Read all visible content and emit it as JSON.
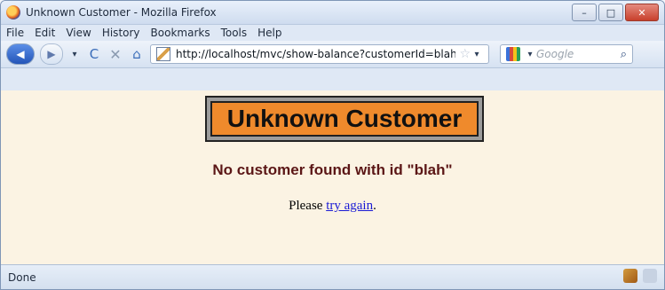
{
  "window": {
    "title": "Unknown Customer - Mozilla Firefox",
    "buttons": [
      "–",
      "□",
      "✕"
    ]
  },
  "menu": {
    "items": [
      {
        "label": "File"
      },
      {
        "label": "Edit"
      },
      {
        "label": "View"
      },
      {
        "label": "History"
      },
      {
        "label": "Bookmarks"
      },
      {
        "label": "Tools"
      },
      {
        "label": "Help"
      }
    ]
  },
  "navigation": {
    "url": "http://localhost/mvc/show-balance?customerId=blah",
    "search_placeholder": "Google",
    "back_glyph": "◀",
    "forward_glyph": "▶",
    "reload_glyph": "C",
    "stop_glyph": "✕",
    "home_glyph": "⌂",
    "star_glyph": "☆",
    "search_glyph": "⌕"
  },
  "page": {
    "heading": "Unknown Customer",
    "message": "No customer found with id \"blah\"",
    "retry_prefix": "Please ",
    "retry_link": "try again",
    "retry_suffix": "."
  },
  "status": {
    "text": "Done"
  },
  "colors": {
    "accent": "#ef8a2c",
    "message": "#5b1616",
    "link": "#1a1ad5",
    "page_bg": "#fbf3e3"
  }
}
